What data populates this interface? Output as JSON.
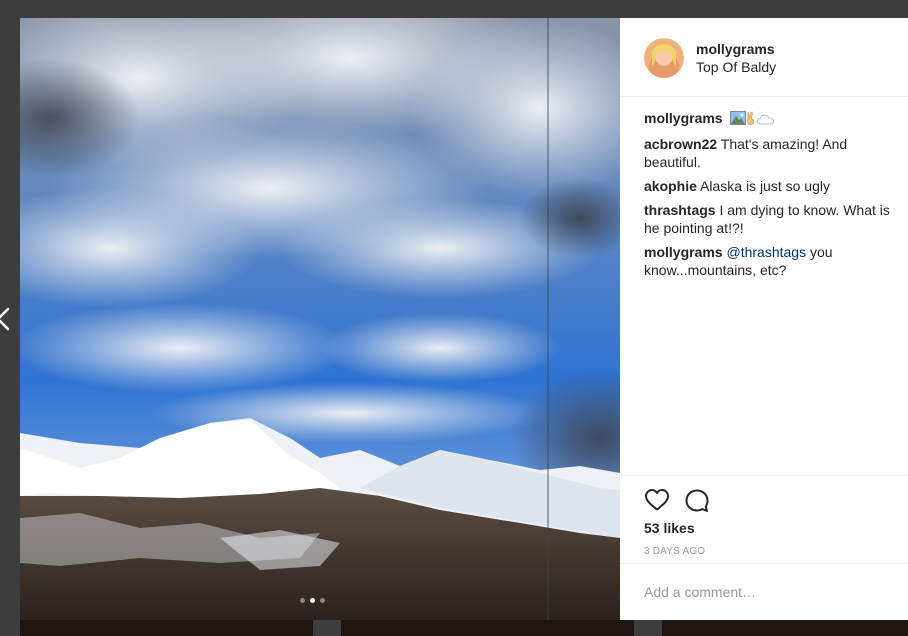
{
  "post": {
    "username": "mollygrams",
    "location": "Top Of Baldy",
    "caption": {
      "user": "mollygrams",
      "emoji": [
        "mountain-photo-emoji",
        "victory-hand-emoji",
        "cloud-emoji"
      ]
    },
    "comments": [
      {
        "user": "acbrown22",
        "text": "That's amazing! And beautiful."
      },
      {
        "user": "akophie",
        "text": "Alaska is just so ugly"
      },
      {
        "user": "thrashtags",
        "text": "I am dying to know. What is he pointing at!?!"
      },
      {
        "user": "mollygrams",
        "mention": "@thrashtags",
        "text": "you know...mountains, etc?"
      }
    ],
    "likes": "53 likes",
    "timestamp": "3 DAYS AGO",
    "add_comment_placeholder": "Add a comment…",
    "carousel": {
      "count": 3,
      "active": 1
    }
  },
  "icons": {
    "like": "heart-outline-icon",
    "comment": "speech-bubble-icon",
    "prev": "chevron-left-icon"
  },
  "colors": {
    "link": "#003569",
    "text": "#262626",
    "muted": "#999999",
    "overlay": "#3d3d3d"
  }
}
